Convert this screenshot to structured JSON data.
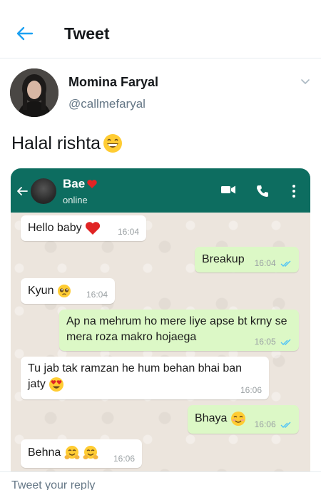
{
  "header": {
    "title": "Tweet"
  },
  "tweet": {
    "display_name": "Momina Faryal",
    "handle": "@callmefaryal",
    "text": "Halal rishta"
  },
  "whatsapp": {
    "contact_name": "Bae",
    "status": "online",
    "messages": [
      {
        "text": "Hello baby",
        "time": "16:04",
        "direction": "in"
      },
      {
        "text": "Breakup",
        "time": "16:04",
        "direction": "out"
      },
      {
        "text": "Kyun",
        "time": "16:04",
        "direction": "in"
      },
      {
        "text": "Ap na mehrum ho mere liye  apse bt krny se mera roza makro hojaega",
        "time": "16:05",
        "direction": "out"
      },
      {
        "text": "Tu jab tak ramzan he hum behan bhai ban jaty",
        "time": "16:06",
        "direction": "in"
      },
      {
        "text": "Bhaya",
        "time": "16:06",
        "direction": "out"
      },
      {
        "text": "Behna",
        "time": "16:06",
        "direction": "in"
      }
    ]
  },
  "reply": {
    "placeholder": "Tweet your reply"
  },
  "colors": {
    "twitter_blue": "#1da1f2",
    "whatsapp_green": "#0d6d60",
    "outgoing_bubble": "#dcf8c6",
    "tick_blue": "#4fc3f7"
  }
}
